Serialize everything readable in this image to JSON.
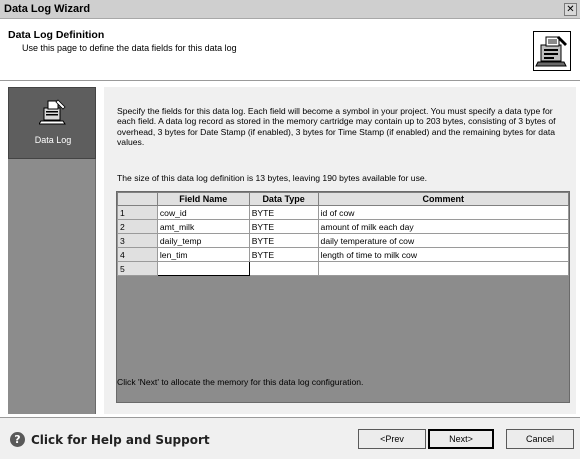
{
  "window": {
    "title": "Data Log Wizard",
    "close_glyph": "✕"
  },
  "header": {
    "title": "Data Log Definition",
    "subtitle": "Use this page to define the data fields for this data log",
    "icon": "data-log-icon"
  },
  "nav": {
    "items": [
      {
        "label": "Data Log",
        "icon": "data-log-icon"
      }
    ]
  },
  "main": {
    "description": "Specify the fields for this data log. Each field will become a symbol in your project. You must specify a data type for each field. A data log record as stored in the memory cartridge may contain up to 203 bytes, consisting of 3 bytes of overhead, 3 bytes for Date Stamp (if enabled), 3 bytes for Time Stamp (if enabled) and the remaining bytes for data values.",
    "size_info": "The size of this data log definition is 13 bytes, leaving 190 bytes available for use.",
    "footnote": "Click 'Next' to allocate the memory for this data log configuration."
  },
  "table": {
    "columns": [
      "Field Name",
      "Data Type",
      "Comment"
    ],
    "rows": [
      {
        "num": "1",
        "field": "cow_id",
        "type": "BYTE",
        "comment": "id of cow"
      },
      {
        "num": "2",
        "field": "amt_milk",
        "type": "BYTE",
        "comment": "amount of milk each day"
      },
      {
        "num": "3",
        "field": "daily_temp",
        "type": "BYTE",
        "comment": "daily temperature of cow"
      },
      {
        "num": "4",
        "field": "len_tim",
        "type": "BYTE",
        "comment": "length of time to milk cow"
      },
      {
        "num": "5",
        "field": "",
        "type": "",
        "comment": ""
      }
    ]
  },
  "footer": {
    "help_label": "Click for Help and Support",
    "help_icon": "help-icon",
    "prev_label": "<Prev",
    "next_label": "Next>",
    "cancel_label": "Cancel"
  }
}
